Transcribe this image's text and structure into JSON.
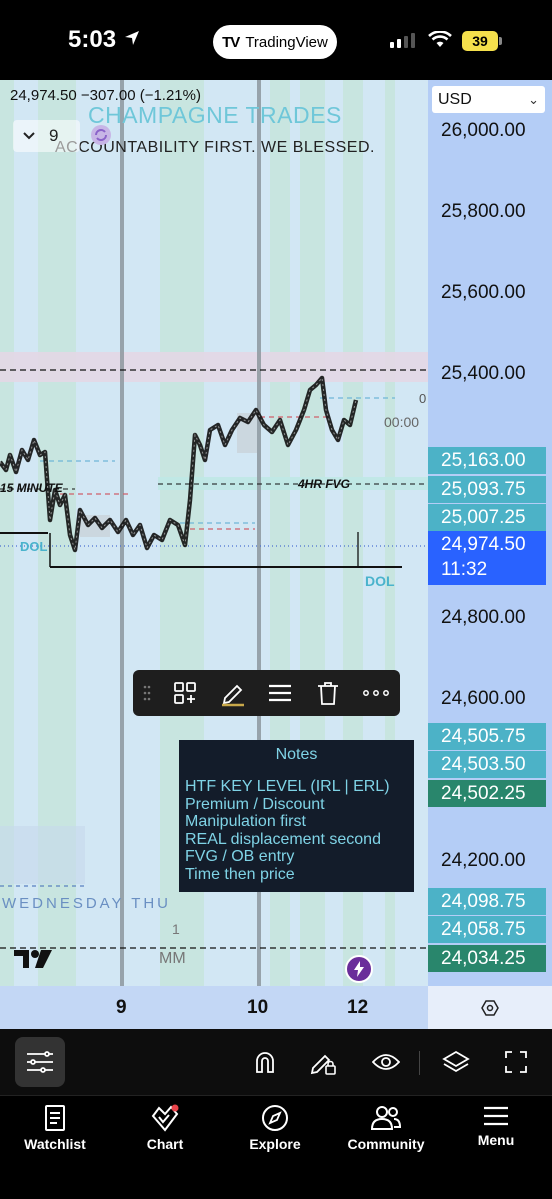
{
  "status_bar": {
    "time": "5:03",
    "app_pill": "TradingView",
    "battery": "39"
  },
  "chart": {
    "quote": "24,974.50  −307.00 (−1.21%)",
    "watermark_title": "CHAMPAGNE TRADES",
    "watermark_subtitle": "ACCOUNTABILITY FIRST. WE BLESSED.",
    "indicator_count": "9",
    "labels": {
      "dol_left": "DOL",
      "dol_right": "DOL",
      "fifteen_minute": "15 MINUTE",
      "four_hr_fvg": "4HR FVG",
      "zero": "0",
      "countdown": "00:00",
      "days": "WEDNESDAY  THU",
      "mm": "MM",
      "one": "1"
    },
    "colors": {
      "background": "#d2e7f4",
      "session_band": "#bfe3cf",
      "premium_zone": "#e3d7e6",
      "fvg_zone": "#bfe8e6",
      "candle": "#111111"
    }
  },
  "notes": {
    "title": "Notes",
    "lines": [
      "HTF KEY LEVEL (IRL | ERL)",
      "Premium / Discount",
      "Manipulation first",
      "REAL displacement second",
      "FVG / OB entry",
      "Time then price"
    ]
  },
  "price_axis": {
    "currency": "USD",
    "ticks": [
      "26,000.00",
      "25,800.00",
      "25,600.00",
      "25,400.00",
      "24,800.00",
      "24,600.00",
      "24,200.00"
    ],
    "tags": [
      {
        "value": "25,163.00",
        "style": "teal"
      },
      {
        "value": "25,093.75",
        "style": "teal"
      },
      {
        "value": "25,007.25",
        "style": "teal"
      },
      {
        "value": "24,505.75",
        "style": "teal"
      },
      {
        "value": "24,503.50",
        "style": "teal"
      },
      {
        "value": "24,502.25",
        "style": "green"
      },
      {
        "value": "24,098.75",
        "style": "teal"
      },
      {
        "value": "24,058.75",
        "style": "teal"
      },
      {
        "value": "24,034.25",
        "style": "green"
      }
    ],
    "current": {
      "price": "24,974.50",
      "timer": "11:32"
    }
  },
  "time_axis": {
    "labels": [
      "9",
      "10",
      "12"
    ]
  },
  "bottom_nav": {
    "items": [
      "Watchlist",
      "Chart",
      "Explore",
      "Community",
      "Menu"
    ]
  }
}
